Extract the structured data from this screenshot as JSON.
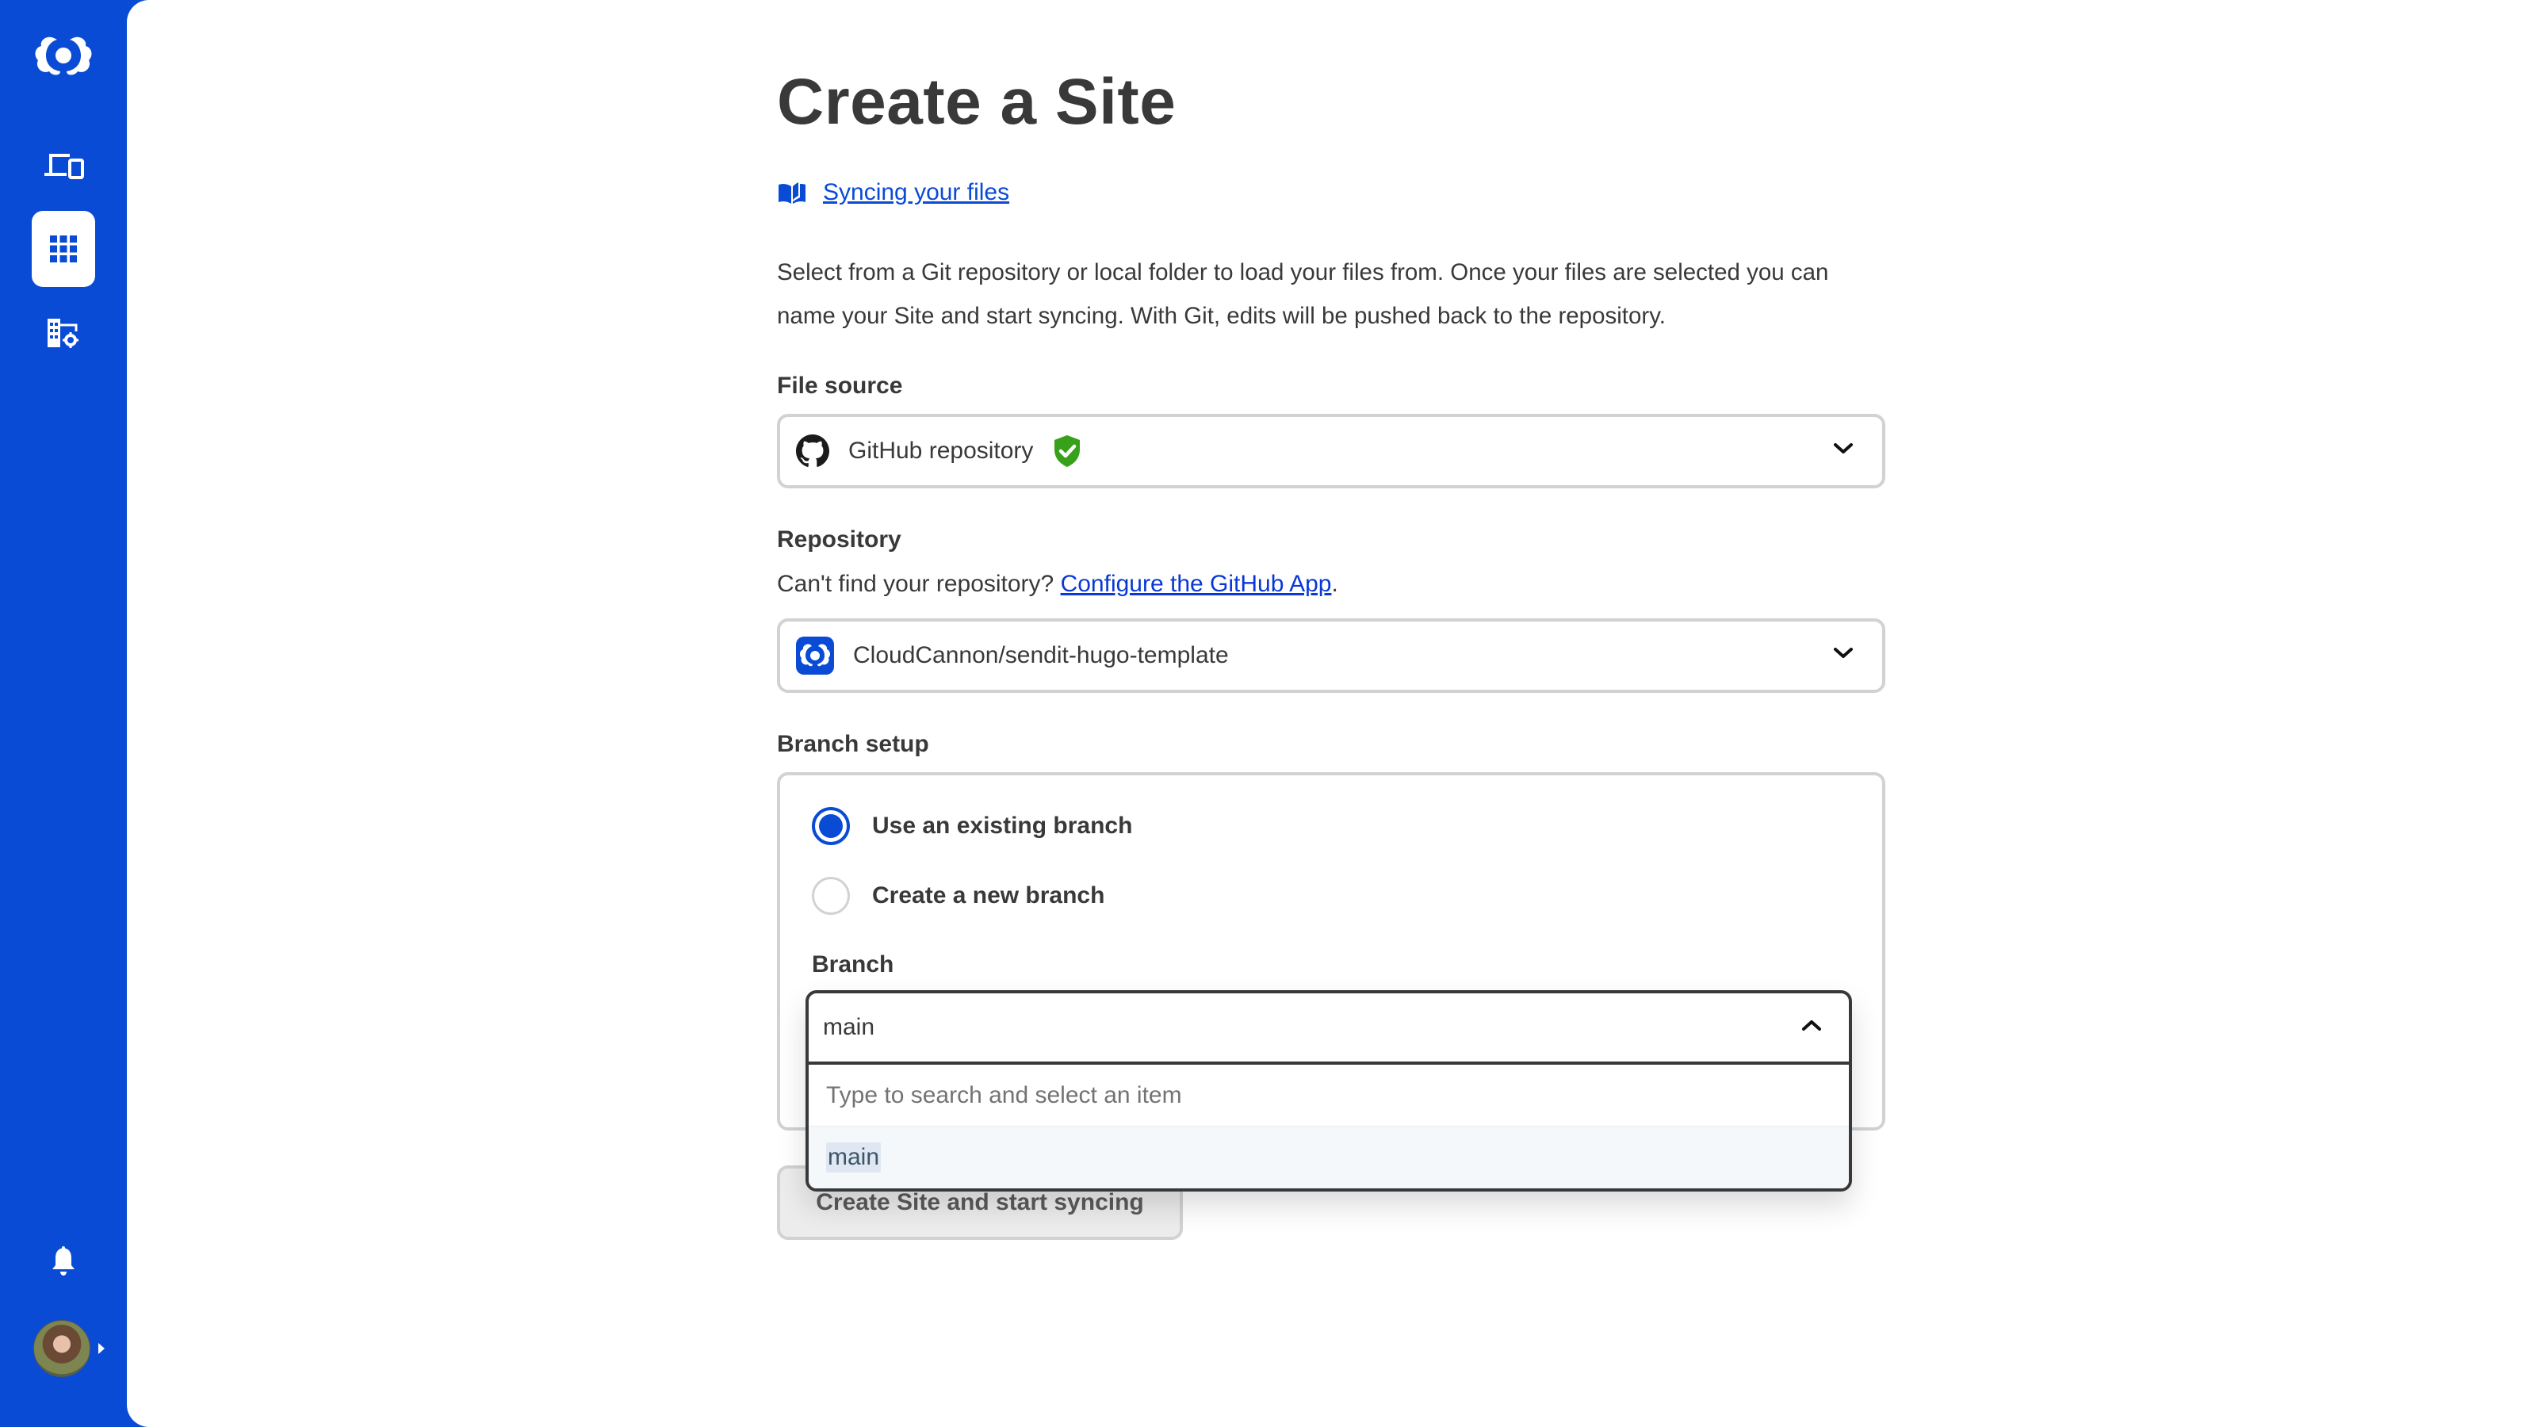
{
  "sidebar": {
    "logo": "cloudcannon-logo-icon",
    "items": [
      {
        "name": "devices",
        "icon": "devices-icon",
        "active": false
      },
      {
        "name": "sites",
        "icon": "grid-icon",
        "active": true
      },
      {
        "name": "organization-settings",
        "icon": "building-gear-icon",
        "active": false
      }
    ],
    "bottom": {
      "notifications_icon": "bell-icon",
      "avatar_icon": "user-avatar"
    }
  },
  "page": {
    "title": "Create a Site",
    "doc_link": {
      "icon": "book-open-icon",
      "label": "Syncing your files"
    },
    "intro": "Select from a Git repository or local folder to load your files from. Once your files are selected you can name your Site and start syncing. With Git, edits will be pushed back to the repository."
  },
  "file_source": {
    "label": "File source",
    "value": "GitHub repository",
    "icon": "github-icon",
    "status_icon": "shield-check-icon",
    "status_color": "#37a11a"
  },
  "repository": {
    "label": "Repository",
    "helper_prefix": "Can't find your repository? ",
    "helper_link": "Configure the GitHub App",
    "helper_suffix": ".",
    "value": "CloudCannon/sendit-hugo-template",
    "icon": "cloudcannon-repo-icon"
  },
  "branch_setup": {
    "label": "Branch setup",
    "options": [
      {
        "label": "Use an existing branch",
        "checked": true
      },
      {
        "label": "Create a new branch",
        "checked": false
      }
    ],
    "branch_label": "Branch",
    "branch_value": "main",
    "dropdown": {
      "search_placeholder": "Type to search and select an item",
      "options": [
        "main"
      ]
    }
  },
  "actions": {
    "submit_label": "Create Site and start syncing"
  },
  "colors": {
    "brand": "#0a4bd6",
    "text": "#393939",
    "border": "#d2d2d2",
    "success": "#37a11a"
  }
}
